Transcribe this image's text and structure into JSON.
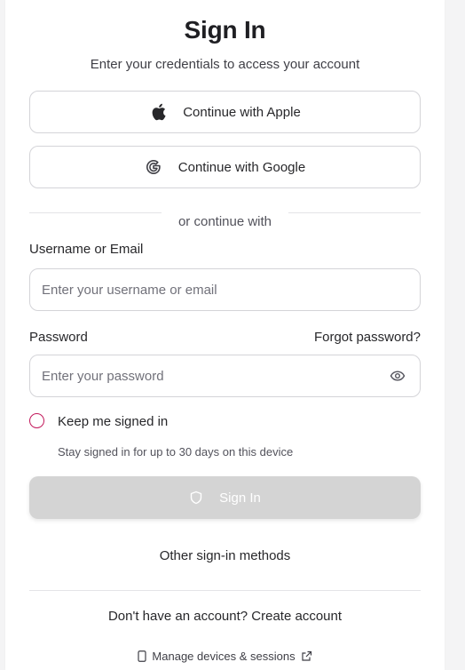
{
  "header": {
    "title": "Sign In",
    "subtitle": "Enter your credentials to access your account"
  },
  "social": {
    "apple_label": "Continue with Apple",
    "google_label": "Continue with Google"
  },
  "divider": {
    "text": "or continue with"
  },
  "username": {
    "label": "Username or Email",
    "placeholder": "Enter your username or email",
    "value": ""
  },
  "password": {
    "label": "Password",
    "forgot_label": "Forgot password?",
    "placeholder": "Enter your password",
    "value": ""
  },
  "remember": {
    "label": "Keep me signed in",
    "hint": "Stay signed in for up to 30 days on this device",
    "checked": false
  },
  "submit": {
    "label": "Sign In",
    "disabled": true
  },
  "other_methods": {
    "label": "Other sign-in methods"
  },
  "signup": {
    "prefix": "Don't have an account?",
    "link_label": "Create account"
  },
  "manage": {
    "label": "Manage devices & sessions"
  },
  "icons": {
    "apple": "apple-icon",
    "google": "google-icon",
    "eye": "eye-icon",
    "shield": "shield-icon",
    "device": "smartphone-icon",
    "external": "external-link-icon"
  },
  "colors": {
    "checkbox_border": "#c2185b",
    "submit_disabled_bg": "#d4d4d4",
    "border": "#d4d4d8"
  }
}
